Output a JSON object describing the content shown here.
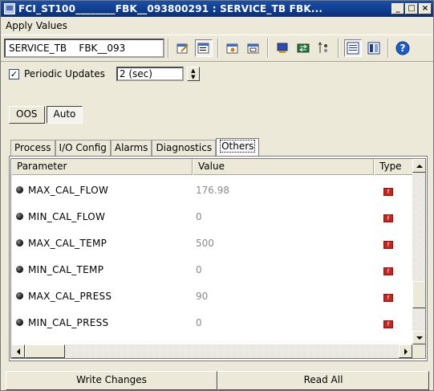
{
  "window": {
    "title": "FCI_ST100________FBK__093800291 : SERVICE_TB     FBK...",
    "controls": {
      "minimize": "_",
      "maximize": "□",
      "close": "×"
    }
  },
  "menu": {
    "items": [
      "Apply Values"
    ]
  },
  "toolbar": {
    "tag_value": "SERVICE_TB    FBK__093",
    "icons": [
      "edit-icon",
      "edit-list-icon",
      "camera-icon",
      "screen-icon",
      "monitor-icon",
      "transfer-icon",
      "sort-icon",
      "detail-view-icon",
      "list-view-icon",
      "help-icon"
    ]
  },
  "periodic": {
    "label": "Periodic Updates",
    "checked": true,
    "interval": "2 (sec)"
  },
  "modes": {
    "oos": "OOS",
    "auto": "Auto",
    "active": "Auto"
  },
  "tabs": [
    "Process",
    "I/O Config",
    "Alarms",
    "Diagnostics",
    "Others"
  ],
  "selected_tab": "Others",
  "grid": {
    "columns": [
      "Parameter",
      "Value",
      "Type"
    ],
    "rows": [
      {
        "parameter": "MAX_CAL_FLOW",
        "value": "176.98"
      },
      {
        "parameter": "MIN_CAL_FLOW",
        "value": "0"
      },
      {
        "parameter": "MAX_CAL_TEMP",
        "value": "500"
      },
      {
        "parameter": "MIN_CAL_TEMP",
        "value": "0"
      },
      {
        "parameter": "MAX_CAL_PRESS",
        "value": "90"
      },
      {
        "parameter": "MIN_CAL_PRESS",
        "value": "0"
      }
    ],
    "type_icon_text": "f"
  },
  "buttons": {
    "write": "Write Changes",
    "read": "Read All"
  }
}
